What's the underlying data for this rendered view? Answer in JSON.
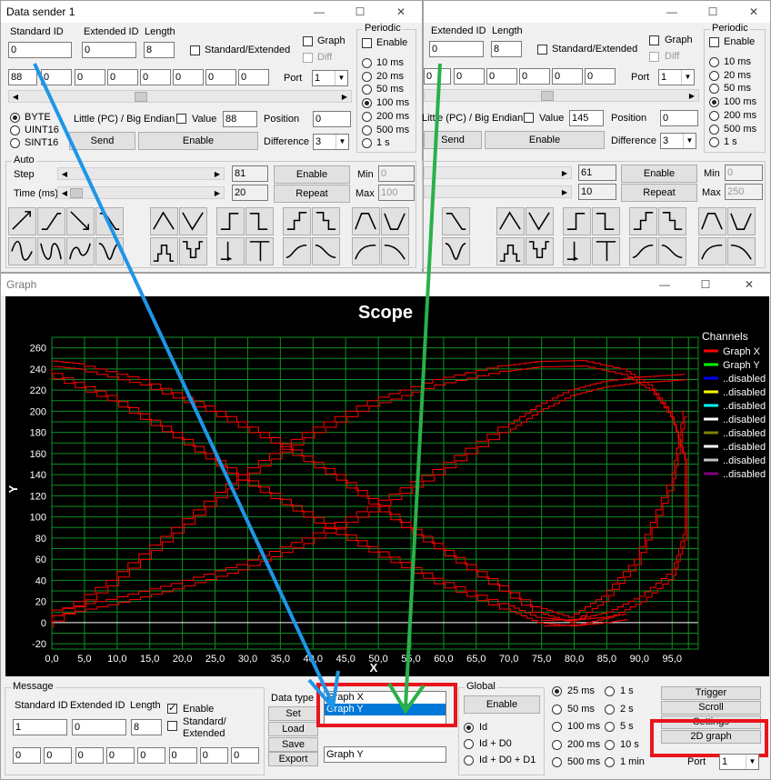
{
  "sender1": {
    "title": "Data sender 1",
    "standard_id_label": "Standard ID",
    "standard_id": "0",
    "extended_id_label": "Extended ID",
    "extended_id": "0",
    "length_label": "Length",
    "length": "8",
    "std_ext_label": "Standard/Extended",
    "graph_label": "Graph",
    "diff_label": "Diff",
    "bytes": [
      "88",
      "0",
      "0",
      "0",
      "0",
      "0",
      "0",
      "0"
    ],
    "port_label": "Port",
    "port": "1",
    "byte_label": "BYTE",
    "uint16_label": "UINT16",
    "sint16_label": "SINT16",
    "endian_label": "Little (PC) / Big Endian",
    "value_label": "Value",
    "value": "88",
    "position_label": "Position",
    "position": "0",
    "send_label": "Send",
    "enable_label": "Enable",
    "difference_label": "Difference",
    "difference": "3",
    "periodic_label": "Periodic",
    "periodic_enable_label": "Enable",
    "periods": [
      "10 ms",
      "20 ms",
      "50 ms",
      "100 ms",
      "200 ms",
      "500 ms",
      "1 s"
    ],
    "period_selected": "100 ms",
    "auto_label": "Auto",
    "step_label": "Step",
    "step_value": "81",
    "time_label": "Time (ms)",
    "time_value": "20",
    "auto_enable_label": "Enable",
    "repeat_label": "Repeat",
    "min_label": "Min",
    "min_value": "0",
    "max_label": "Max",
    "max_value": "100"
  },
  "sender2": {
    "extended_id_label": "Extended ID",
    "extended_id": "0",
    "length_label": "Length",
    "length": "8",
    "std_ext_label": "Standard/Extended",
    "graph_label": "Graph",
    "diff_label": "Diff",
    "bytes": [
      "0",
      "0",
      "0",
      "0",
      "0",
      "0"
    ],
    "port_label": "Port",
    "port": "1",
    "endian_label": "Little (PC) / Big Endian",
    "value_label": "Value",
    "value": "145",
    "position_label": "Position",
    "position": "0",
    "send_label": "Send",
    "enable_label": "Enable",
    "difference_label": "Difference",
    "difference": "3",
    "periodic_label": "Periodic",
    "periodic_enable_label": "Enable",
    "periods": [
      "10 ms",
      "20 ms",
      "50 ms",
      "100 ms",
      "200 ms",
      "500 ms",
      "1 s"
    ],
    "period_selected": "100 ms",
    "step_value": "61",
    "time_value": "10",
    "auto_enable_label": "Enable",
    "repeat_label": "Repeat",
    "min_label": "Min",
    "min_value": "0",
    "max_label": "Max",
    "max_value": "250"
  },
  "graph_window": {
    "title": "Graph",
    "scope_title": "Scope",
    "channels_title": "Channels",
    "channels": [
      {
        "name": "Graph X",
        "color": "#ff0000"
      },
      {
        "name": "Graph Y",
        "color": "#00ff00"
      },
      {
        "name": "..disabled",
        "color": "#0000ff"
      },
      {
        "name": "..disabled",
        "color": "#ffff00"
      },
      {
        "name": "..disabled",
        "color": "#00ffff"
      },
      {
        "name": "..disabled",
        "color": "#ffffff"
      },
      {
        "name": "..disabled",
        "color": "#808000"
      },
      {
        "name": "..disabled",
        "color": "#ffffff"
      },
      {
        "name": "..disabled",
        "color": "#c0c0c0"
      },
      {
        "name": "..disabled",
        "color": "#800080"
      }
    ],
    "message_label": "Message",
    "msg_standard_id_label": "Standard ID",
    "msg_extended_id_label": "Extended ID",
    "msg_length_label": "Length",
    "msg_enable_label": "Enable",
    "msg_std_ext_label": "Standard/\nExtended",
    "msg_standard_id": "1",
    "msg_extended_id": "0",
    "msg_length": "8",
    "msg_bytes": [
      "0",
      "0",
      "0",
      "0",
      "0",
      "0",
      "0",
      "0"
    ],
    "data_type_label": "Data type",
    "set_label": "Set",
    "load_label": "Load",
    "save_label": "Save",
    "export_label": "Export",
    "graph_list": [
      "Graph X",
      "Graph Y"
    ],
    "graph_list_selected": "Graph Y",
    "graph_name_input": "Graph Y",
    "global_label": "Global",
    "global_enable_label": "Enable",
    "id_options": [
      "Id",
      "Id + D0",
      "Id + D0 + D1"
    ],
    "id_selected": "Id",
    "rates_col1": [
      "25 ms",
      "50 ms",
      "100 ms",
      "200 ms",
      "500 ms"
    ],
    "rates_col2": [
      "1 s",
      "2 s",
      "5 s",
      "10 s",
      "1 min"
    ],
    "rate_selected": "25 ms",
    "trigger_label": "Trigger",
    "scroll_label": "Scroll",
    "settings_label": "Settings",
    "graph2d_label": "2D graph",
    "port_label": "Port",
    "port": "1"
  },
  "chart_data": {
    "type": "line",
    "title": "Scope",
    "xlabel": "X",
    "ylabel": "Y",
    "xlim": [
      0,
      99
    ],
    "ylim": [
      -25,
      270
    ],
    "x_ticks": [
      "0,0",
      "5,0",
      "10,0",
      "15,0",
      "20,0",
      "25,0",
      "30,0",
      "35,0",
      "40,0",
      "45,0",
      "50,0",
      "55,0",
      "60,0",
      "65,0",
      "70,0",
      "75,0",
      "80,0",
      "85,0",
      "90,0",
      "95,0"
    ],
    "y_ticks": [
      -20,
      0,
      20,
      40,
      60,
      80,
      100,
      120,
      140,
      160,
      180,
      200,
      220,
      240,
      260
    ],
    "grid": true,
    "legend": "right",
    "series": [
      {
        "name": "Graph X",
        "color": "#ff0000",
        "x": [
          0,
          10,
          20,
          30,
          40,
          50,
          60,
          70,
          75,
          80,
          85,
          90,
          95,
          97
        ],
        "y": [
          10,
          22,
          37,
          55,
          80,
          110,
          145,
          185,
          205,
          220,
          228,
          232,
          234,
          235
        ]
      },
      {
        "name": "Graph X",
        "color": "#ff0000",
        "x": [
          0,
          5,
          15,
          25,
          35,
          45,
          55,
          65,
          75,
          80,
          85,
          90,
          95,
          97
        ],
        "y": [
          248,
          245,
          230,
          205,
          175,
          140,
          95,
          55,
          15,
          5,
          25,
          60,
          130,
          200
        ]
      },
      {
        "name": "Graph X",
        "color": "#ff0000",
        "x": [
          0,
          10,
          20,
          30,
          40,
          50,
          60,
          70,
          75,
          80,
          85,
          88
        ],
        "y": [
          240,
          215,
          180,
          140,
          105,
          72,
          42,
          18,
          5,
          2,
          5,
          8
        ]
      },
      {
        "name": "Graph X",
        "color": "#ff0000",
        "x": [
          0,
          10,
          20,
          30,
          40,
          50,
          60,
          70,
          75,
          82
        ],
        "y": [
          0,
          40,
          90,
          140,
          180,
          210,
          230,
          243,
          247,
          248
        ]
      },
      {
        "name": "Graph X",
        "color": "#ff0000",
        "x": [
          82,
          88,
          92,
          95,
          97,
          97,
          95,
          90,
          85,
          80,
          75
        ],
        "y": [
          248,
          240,
          225,
          200,
          160,
          90,
          50,
          25,
          10,
          3,
          2
        ]
      }
    ]
  }
}
